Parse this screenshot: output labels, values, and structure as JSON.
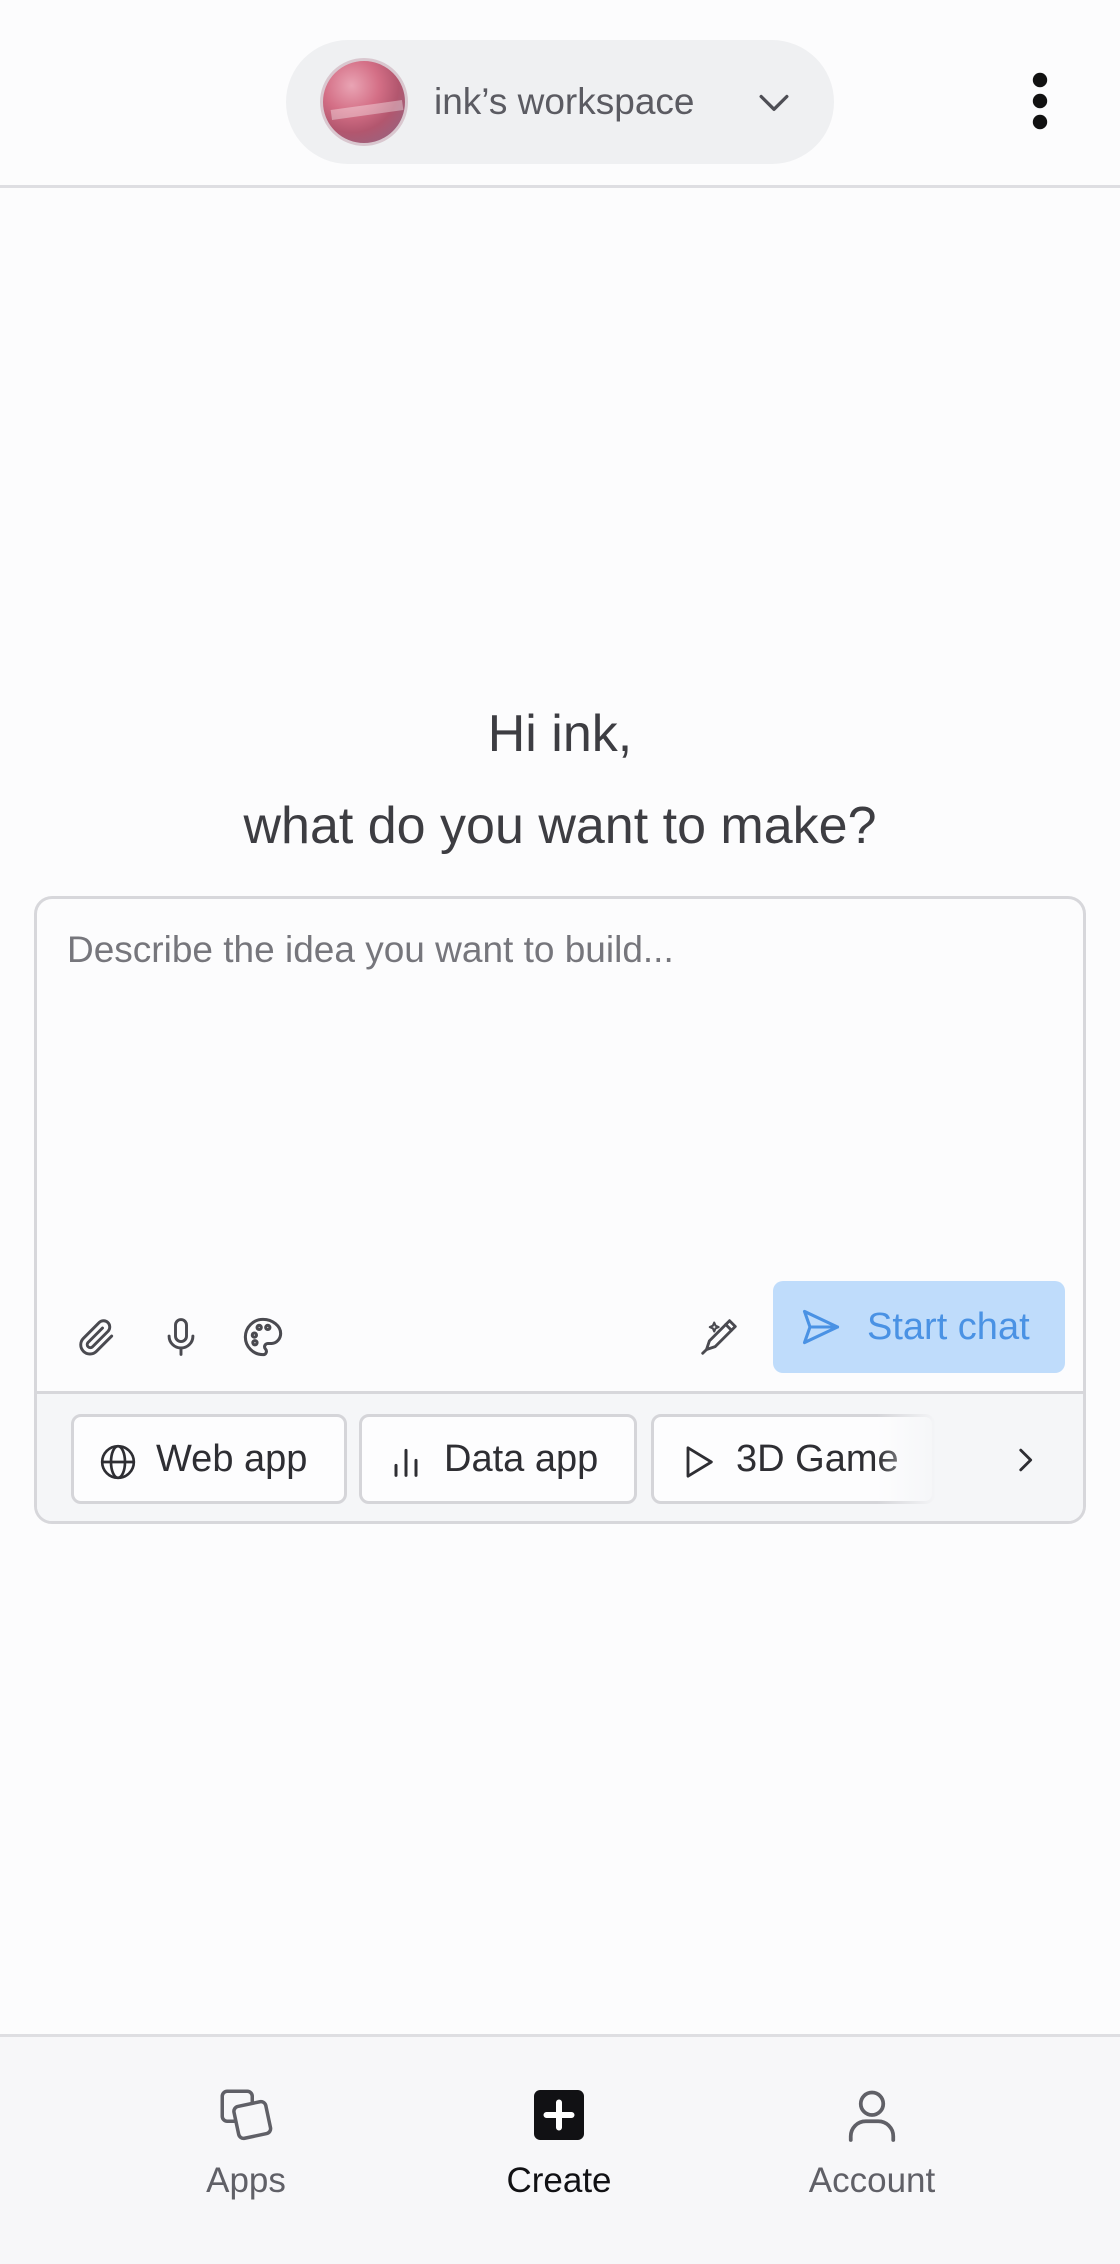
{
  "header": {
    "workspace_name": "ink’s workspace",
    "avatar_icon": "workspace-avatar",
    "chevron_icon": "chevron-down-icon",
    "menu_icon": "kebab-menu-icon"
  },
  "greeting": {
    "line1": "Hi ink,",
    "line2": "what do you want to make?"
  },
  "composer": {
    "placeholder": "Describe the idea you want to build...",
    "value": "",
    "tools": [
      "paperclip-icon",
      "microphone-icon",
      "palette-icon",
      "magic-pen-icon"
    ],
    "start_button": {
      "label": "Start chat",
      "icon": "send-icon",
      "background": "#bfdcfb",
      "color": "#4a92e4"
    },
    "chips": [
      {
        "label": "Web app",
        "icon": "globe-icon"
      },
      {
        "label": "Data app",
        "icon": "bar-chart-icon"
      },
      {
        "label": "3D Game",
        "icon": "play-icon"
      }
    ],
    "more_icon": "chevron-right-icon"
  },
  "bottom_nav": {
    "items": [
      {
        "label": "Apps",
        "icon": "apps-icon",
        "active": false
      },
      {
        "label": "Create",
        "icon": "plus-square-icon",
        "active": true
      },
      {
        "label": "Account",
        "icon": "user-icon",
        "active": false
      }
    ]
  }
}
